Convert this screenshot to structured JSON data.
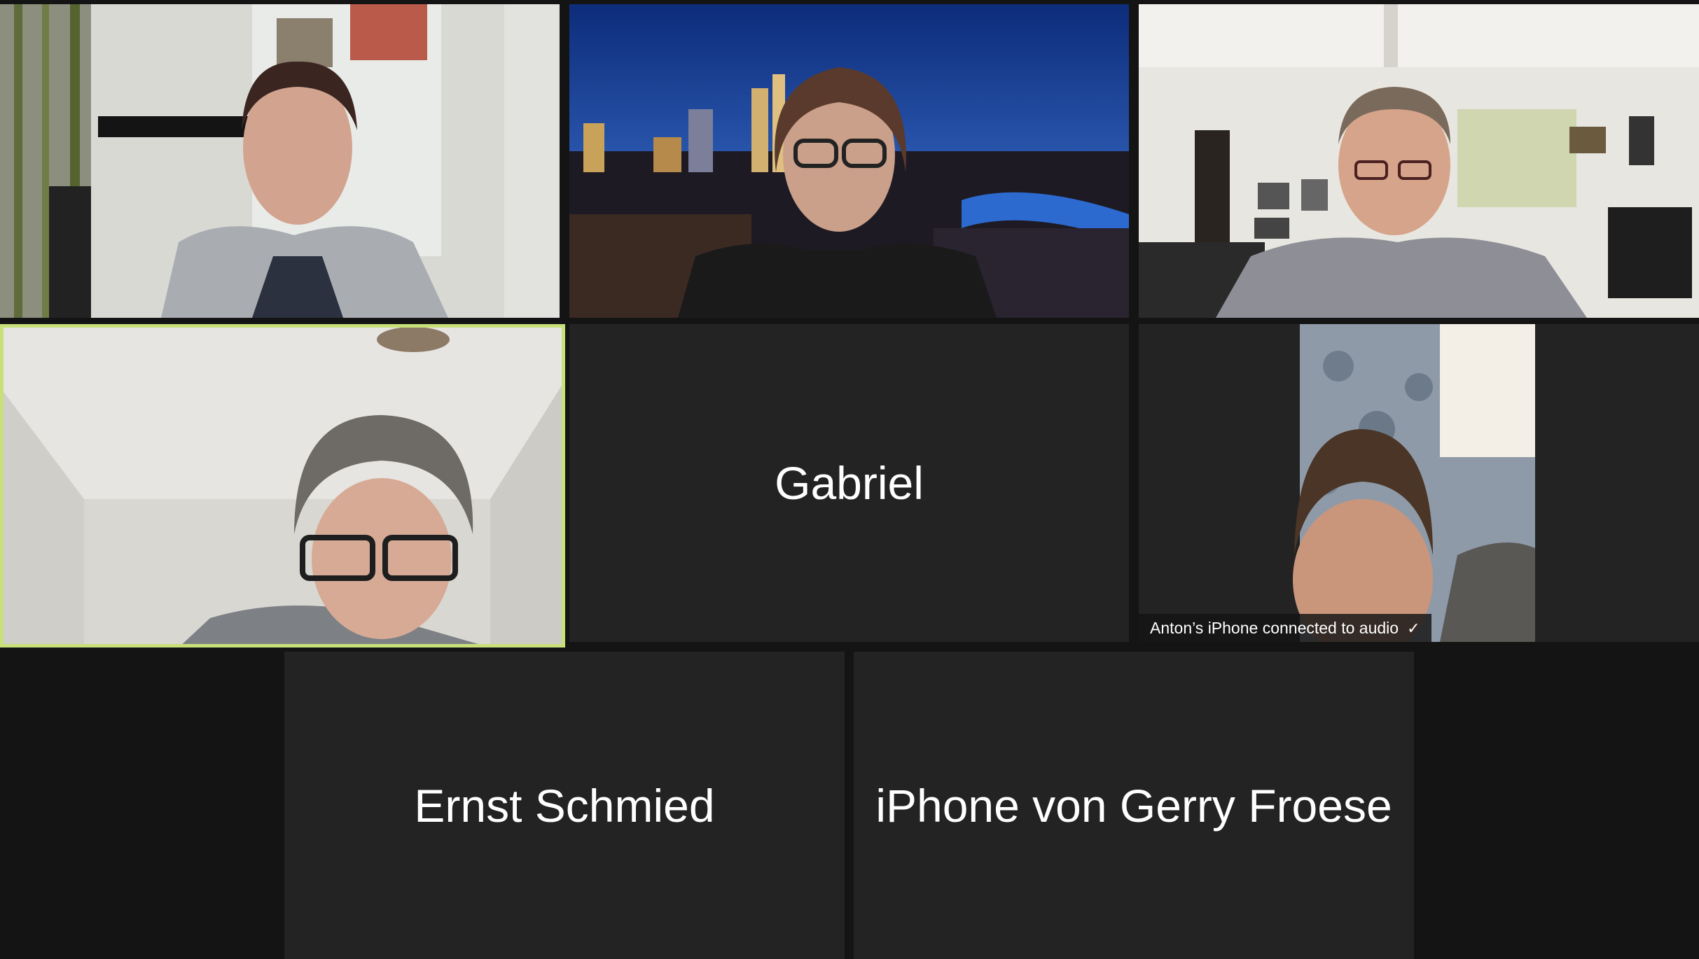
{
  "participants": [
    {
      "id": "p1",
      "name": "",
      "video": true
    },
    {
      "id": "p2",
      "name": "",
      "video": true
    },
    {
      "id": "p3",
      "name": "",
      "video": true
    },
    {
      "id": "p4",
      "name": "",
      "video": true,
      "active_speaker": true
    },
    {
      "id": "p5",
      "name": "Gabriel",
      "video": false
    },
    {
      "id": "p6",
      "name": "",
      "video": true,
      "status_badge": "Anton’s iPhone connected to audio",
      "status_icon": "checkmark-icon"
    },
    {
      "id": "p7",
      "name": "Ernst Schmied",
      "video": false
    },
    {
      "id": "p8",
      "name": "iPhone von Gerry Froese",
      "video": false
    }
  ],
  "colors": {
    "background": "#141414",
    "tile": "#232323",
    "active_speaker_border": "#c8e07a",
    "name_text": "#ffffff"
  }
}
